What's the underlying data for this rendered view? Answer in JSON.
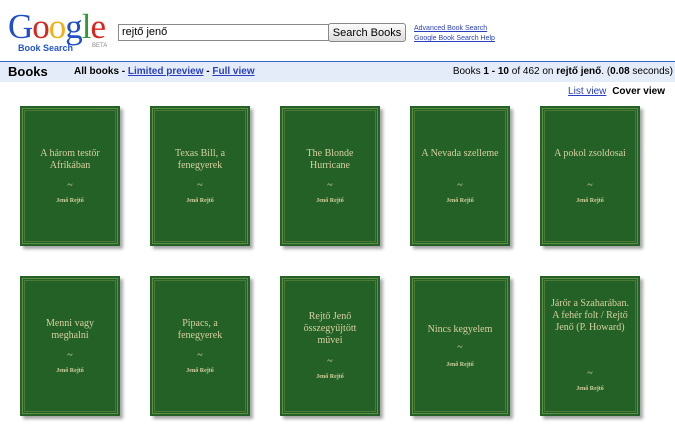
{
  "header": {
    "logo": {
      "letters": [
        "G",
        "o",
        "o",
        "g",
        "l",
        "e"
      ],
      "colors": [
        "#2050c8",
        "#d8261c",
        "#f0b114",
        "#2050c8",
        "#2e9b35",
        "#d8261c"
      ],
      "sub": "Book Search",
      "beta": "BETA"
    },
    "search": {
      "value": "rejtő jenő",
      "button_label": "Search Books"
    },
    "links": [
      "Advanced Book Search",
      "Google Book Search Help"
    ]
  },
  "results_bar": {
    "title": "Books",
    "nav_all": "All books",
    "sep1": " - ",
    "nav_limited": "Limited preview",
    "sep2": " - ",
    "nav_full": "Full view",
    "stats_prefix": "Books ",
    "stats_range": "1 - 10",
    "stats_of": " of ",
    "stats_total": "462",
    "stats_on": " on ",
    "stats_query": "rejtő jenő",
    "stats_paren": ". (",
    "stats_time": "0.08",
    "stats_suffix": " seconds)"
  },
  "views": {
    "list": "List view",
    "cover": "Cover view"
  },
  "books": [
    {
      "title": "A három testőr Afrikában",
      "tilde": "~",
      "author": "Jenő Rejtő"
    },
    {
      "title": "Texas Bill, a fenegyerek",
      "tilde": "~",
      "author": "Jenő Rejtő"
    },
    {
      "title": "The Blonde Hurricane",
      "tilde": "~",
      "author": "Jenő Rejtő"
    },
    {
      "title": "A Nevada szelleme",
      "tilde": "~",
      "author": "Jenő Rejtő"
    },
    {
      "title": "A pokol zsoldosai",
      "tilde": "~",
      "author": "Jenő Rejtő"
    },
    {
      "title": "Menni vagy meghalni",
      "tilde": "~",
      "author": "Jenő Rejtő"
    },
    {
      "title": "Pipacs, a fenegyerek",
      "tilde": "~",
      "author": "Jenő Rejtő"
    },
    {
      "title": "Rejtő Jenő összegyűjtött művei",
      "tilde": "~",
      "author": "Jenő Rejtő"
    },
    {
      "title": "Nincs kegyelem",
      "tilde": "~",
      "author": "Jenő Rejtő"
    },
    {
      "title": "Járőr a Szaharában. A fehér folt / Rejtő Jenő (P. Howard)",
      "tilde": "~",
      "author": "Jenő Rejtő"
    }
  ]
}
